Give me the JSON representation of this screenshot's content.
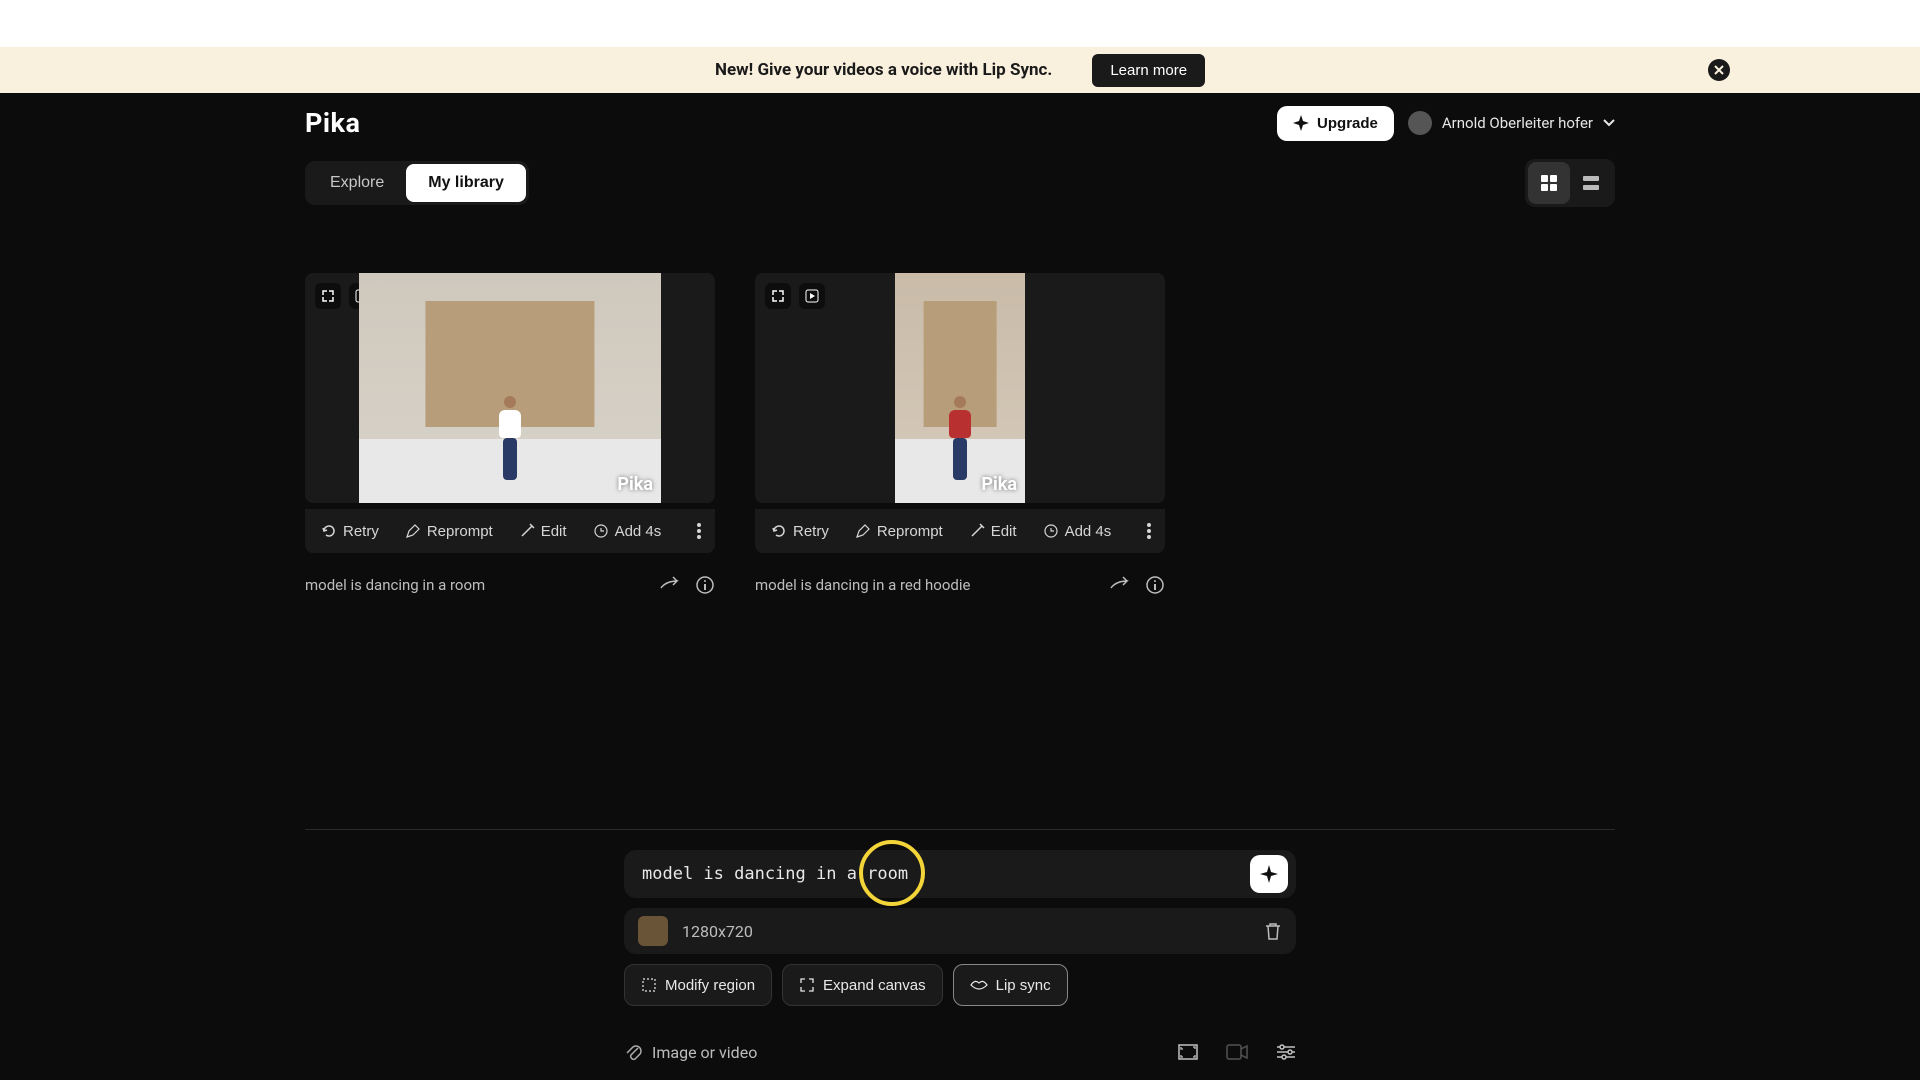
{
  "banner": {
    "text_prefix": "New! ",
    "text_bold": "Give your videos a voice with Lip Sync.",
    "cta": "Learn more"
  },
  "header": {
    "logo": "Pika",
    "upgrade": "Upgrade",
    "username": "Arnold Oberleiter hofer"
  },
  "tabs": {
    "explore": "Explore",
    "library": "My library"
  },
  "cards": [
    {
      "actions": {
        "retry": "Retry",
        "reprompt": "Reprompt",
        "edit": "Edit",
        "add4s": "Add 4s"
      },
      "caption": "model is dancing in a room",
      "watermark": "Pika"
    },
    {
      "actions": {
        "retry": "Retry",
        "reprompt": "Reprompt",
        "edit": "Edit",
        "add4s": "Add 4s"
      },
      "caption": "model is dancing in a red hoodie",
      "watermark": "Pika"
    }
  ],
  "composer": {
    "prompt_value": "model is dancing in a room",
    "ref_dims": "1280x720",
    "tools": {
      "modify": "Modify region",
      "expand": "Expand canvas",
      "lipsync": "Lip sync"
    },
    "footer_hint": "Image or video"
  }
}
